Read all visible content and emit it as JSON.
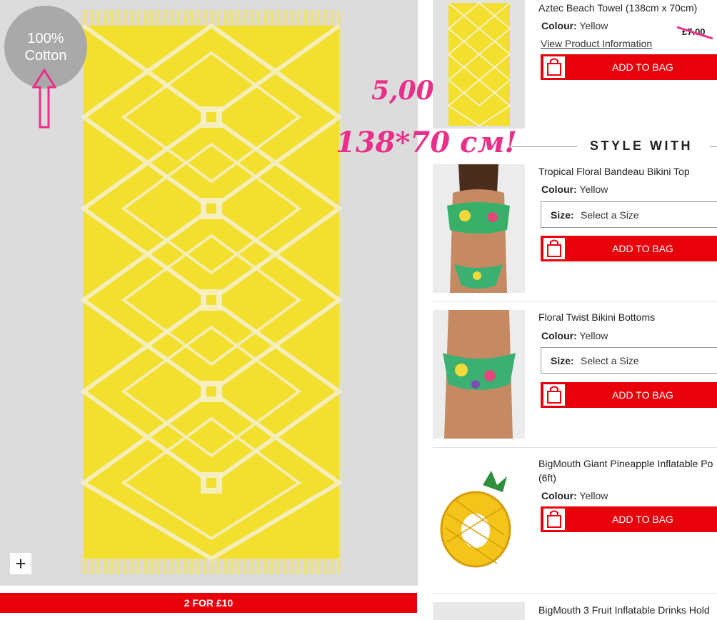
{
  "hero": {
    "badge_line1": "100%",
    "badge_line2": "Cotton",
    "promo": "2 FOR £10",
    "zoom_symbol": "+"
  },
  "annotations": {
    "price": "5,00",
    "size": "138*70 см!"
  },
  "main_product": {
    "title": "Aztec Beach Towel (138cm x 70cm)",
    "colour_label": "Colour:",
    "colour_value": "Yellow",
    "old_price": "£7.00",
    "view_link": "View Product Information",
    "add_label": "ADD TO BAG"
  },
  "style_with": {
    "heading": "STYLE WITH",
    "items": [
      {
        "title": "Tropical Floral Bandeau Bikini Top",
        "colour_label": "Colour:",
        "colour_value": "Yellow",
        "size_label": "Size:",
        "size_value": "Select a Size",
        "add_label": "ADD TO BAG"
      },
      {
        "title": "Floral Twist Bikini Bottoms",
        "colour_label": "Colour:",
        "colour_value": "Yellow",
        "size_label": "Size:",
        "size_value": "Select a Size",
        "add_label": "ADD TO BAG"
      },
      {
        "title": "BigMouth Giant Pineapple Inflatable Po",
        "title_line2": "(6ft)",
        "colour_label": "Colour:",
        "colour_value": "Yellow",
        "add_label": "ADD TO BAG"
      },
      {
        "title": "BigMouth 3 Fruit Inflatable Drinks Hold"
      }
    ]
  },
  "colors": {
    "brand_red": "#e8000b",
    "towel_yellow": "#f2df2e",
    "annotation_pink": "#ea2f8b"
  },
  "icons": [
    "bag-icon",
    "plus-icon",
    "arrow-up-icon",
    "aztec-towel-image",
    "bikini-top-image",
    "bikini-bottoms-image",
    "pineapple-float-image"
  ]
}
